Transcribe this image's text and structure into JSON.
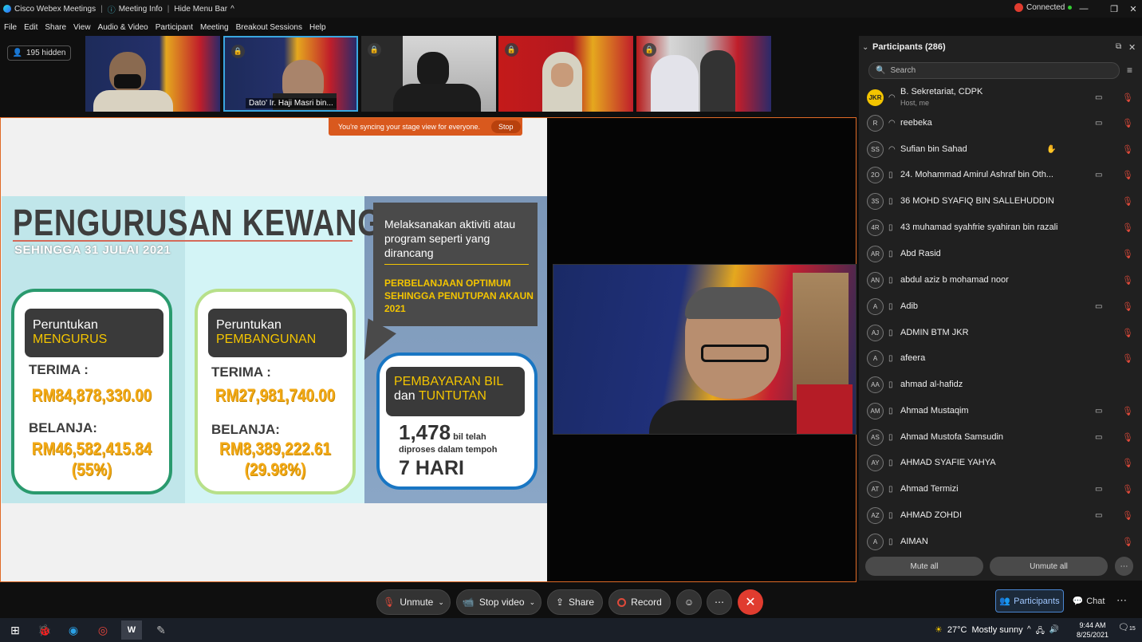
{
  "titlebar": {
    "app": "Cisco Webex Meetings",
    "meeting_info": "Meeting Info",
    "hide_menu": "Hide Menu Bar",
    "status": "Connected"
  },
  "menu": [
    "File",
    "Edit",
    "Share",
    "View",
    "Audio & Video",
    "Participant",
    "Meeting",
    "Breakout Sessions",
    "Help"
  ],
  "hidden_count": "195 hidden",
  "thumbnail_name": "Dato' Ir. Haji Masri bin...",
  "sync": {
    "message": "You're syncing your stage view for everyone.",
    "stop": "Stop"
  },
  "slide": {
    "title": "PENGURUSAN KEWANGAN",
    "subtitle": "SEHINGGA 31 JULAI 2021",
    "card1": {
      "h1": "Peruntukan",
      "h2": "MENGURUS",
      "terima": "TERIMA :",
      "terima_val": "RM84,878,330.00",
      "belanja": "BELANJA:",
      "belanja_val": "RM46,582,415.84",
      "pct": "(55%)"
    },
    "card2": {
      "h1": "Peruntukan",
      "h2": "PEMBANGUNAN",
      "terima": "TERIMA :",
      "terima_val": "RM27,981,740.00",
      "belanja": "BELANJA:",
      "belanja_val": "RM8,389,222.61",
      "pct": "(29.98%)"
    },
    "bubble": {
      "text": "Melaksanakan aktiviti atau program seperti yang dirancang",
      "highlight": "PERBELANJAAN OPTIMUM SEHINGGA PENUTUPAN AKAUN 2021"
    },
    "card3": {
      "h1": "PEMBAYARAN BIL",
      "h2a": "dan",
      "h2b": "TUNTUTAN",
      "num": "1,478",
      "num_tail": "bil telah",
      "line2": "diproses dalam tempoh",
      "days": "7 HARI"
    }
  },
  "participants": {
    "title": "Participants (286)",
    "search_placeholder": "Search",
    "rows": [
      {
        "initials": "JKR",
        "name": "B. Sekretariat, CDPK",
        "sub": "Host, me",
        "video": true
      },
      {
        "initials": "R",
        "name": "reebeka",
        "sub": "",
        "video": true
      },
      {
        "initials": "SS",
        "name": "Sufian bin Sahad",
        "sub": "",
        "video": false
      },
      {
        "initials": "2O",
        "name": "24. Mohammad Amirul Ashraf bin Oth...",
        "sub": "",
        "video": true
      },
      {
        "initials": "3S",
        "name": "36 MOHD SYAFIQ BIN SALLEHUDDIN",
        "sub": "",
        "video": false
      },
      {
        "initials": "4R",
        "name": "43 muhamad syahfrie syahiran bin razali",
        "sub": "",
        "video": false
      },
      {
        "initials": "AR",
        "name": "Abd Rasid",
        "sub": "",
        "video": false
      },
      {
        "initials": "AN",
        "name": "abdul aziz b mohamad noor",
        "sub": "",
        "video": false
      },
      {
        "initials": "A",
        "name": "Adib",
        "sub": "",
        "video": true
      },
      {
        "initials": "AJ",
        "name": "ADMIN BTM JKR",
        "sub": "",
        "video": false
      },
      {
        "initials": "A",
        "name": "afeera",
        "sub": "",
        "video": false
      },
      {
        "initials": "AA",
        "name": "ahmad al-hafidz",
        "sub": "",
        "video": false
      },
      {
        "initials": "AM",
        "name": "Ahmad Mustaqim",
        "sub": "",
        "video": true
      },
      {
        "initials": "AS",
        "name": "Ahmad Mustofa Samsudin",
        "sub": "",
        "video": true
      },
      {
        "initials": "AY",
        "name": "AHMAD SYAFIE YAHYA",
        "sub": "",
        "video": false
      },
      {
        "initials": "AT",
        "name": "Ahmad Termizi",
        "sub": "",
        "video": true
      },
      {
        "initials": "AZ",
        "name": "AHMAD ZOHDI",
        "sub": "",
        "video": true
      },
      {
        "initials": "A",
        "name": "AIMAN",
        "sub": "",
        "video": false
      }
    ],
    "mute_all": "Mute all",
    "unmute_all": "Unmute all"
  },
  "controls": {
    "unmute": "Unmute",
    "stop_video": "Stop video",
    "share": "Share",
    "record": "Record",
    "participants": "Participants",
    "chat": "Chat"
  },
  "taskbar": {
    "weather": "27°C",
    "weather_desc": "Mostly sunny",
    "time": "9:44 AM",
    "date": "8/25/2021",
    "notif": "15"
  },
  "colors": {
    "accent": "#e06a26",
    "leave": "#e03c2f",
    "muted": "#e04a3a",
    "slide_yellow": "#f3a916"
  }
}
